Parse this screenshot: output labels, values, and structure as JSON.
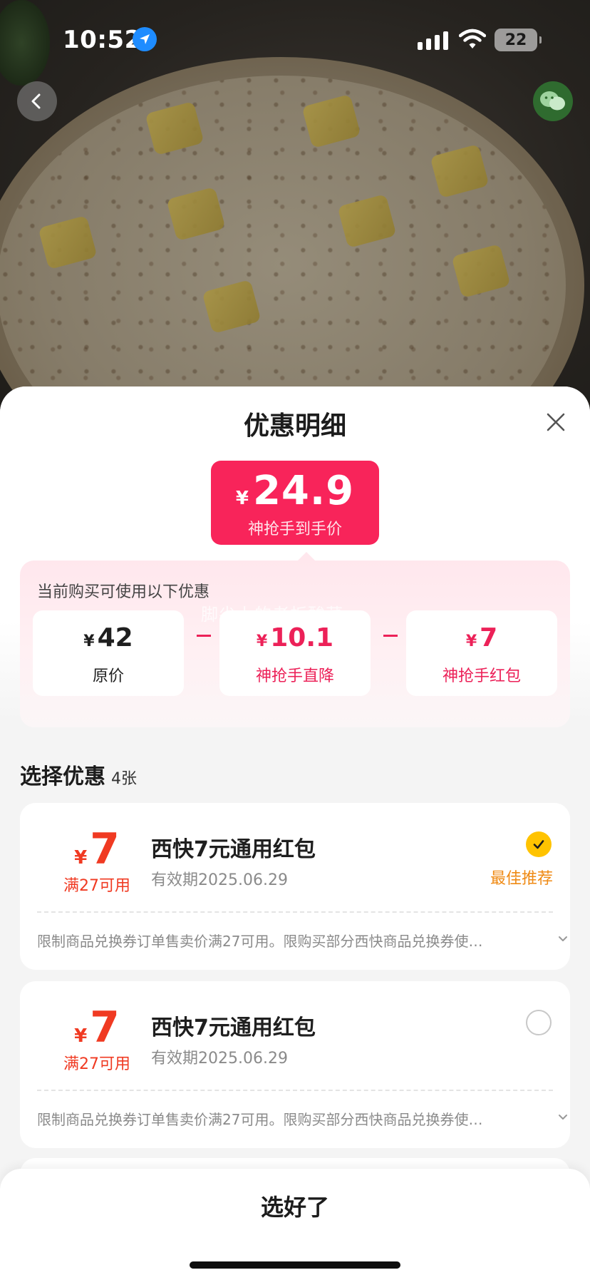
{
  "status_bar": {
    "time": "10:52",
    "battery": "22"
  },
  "sheet": {
    "title": "优惠明细"
  },
  "price_badge": {
    "currency": "¥",
    "amount": "24.9",
    "caption": "神抢手到手价"
  },
  "promo": {
    "hint": "当前购买可使用以下优惠",
    "watermark": "脚尖上的老板酸菜",
    "items": [
      {
        "currency": "¥",
        "value": "42",
        "label": "原价"
      },
      {
        "currency": "¥",
        "value": "10.1",
        "label": "神抢手直降"
      },
      {
        "currency": "¥",
        "value": "7",
        "label": "神抢手红包"
      }
    ]
  },
  "choose": {
    "title": "选择优惠",
    "count": "4张"
  },
  "coupons": [
    {
      "currency": "¥",
      "amount": "7",
      "threshold": "满27可用",
      "name": "西快7元通用红包",
      "validity": "有效期2025.06.29",
      "selected": true,
      "tag": "最佳推荐",
      "description": "限制商品兑换券订单售卖价满27可用。限购买部分西快商品兑换券使…"
    },
    {
      "currency": "¥",
      "amount": "7",
      "threshold": "满27可用",
      "name": "西快7元通用红包",
      "validity": "有效期2025.06.29",
      "selected": false,
      "tag": "",
      "description": "限制商品兑换券订单售卖价满27可用。限购买部分西快商品兑换券使…"
    }
  ],
  "footer": {
    "confirm_label": "选好了"
  },
  "colors": {
    "accent": "#f8245a",
    "coupon_red": "#f03a22",
    "best_orange": "#ef8a14",
    "check_yellow": "#ffc300"
  }
}
